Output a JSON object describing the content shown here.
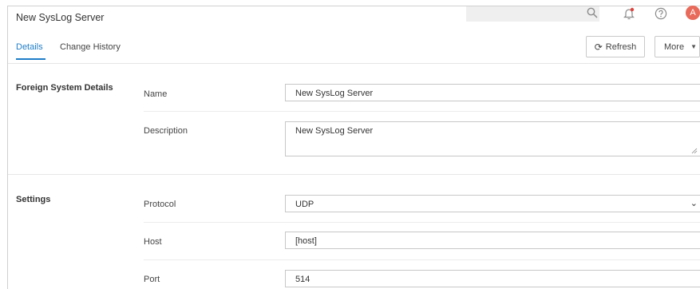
{
  "header": {
    "title": "New SysLog Server",
    "avatar_initial": "A"
  },
  "tabs": [
    {
      "label": "Details"
    },
    {
      "label": "Change History"
    }
  ],
  "toolbar": {
    "refresh_label": "Refresh",
    "more_label": "More"
  },
  "sections": {
    "foreign": {
      "title": "Foreign System Details",
      "name_label": "Name",
      "name_value": "New SysLog Server",
      "description_label": "Description",
      "description_value": "New SysLog Server"
    },
    "settings": {
      "title": "Settings",
      "protocol_label": "Protocol",
      "protocol_value": "UDP",
      "host_label": "Host",
      "host_value": "[host]",
      "port_label": "Port",
      "port_value": "514"
    }
  },
  "colors": {
    "accent": "#1f7dc8",
    "avatar": "#e86a5a",
    "notification": "#e0433d"
  }
}
